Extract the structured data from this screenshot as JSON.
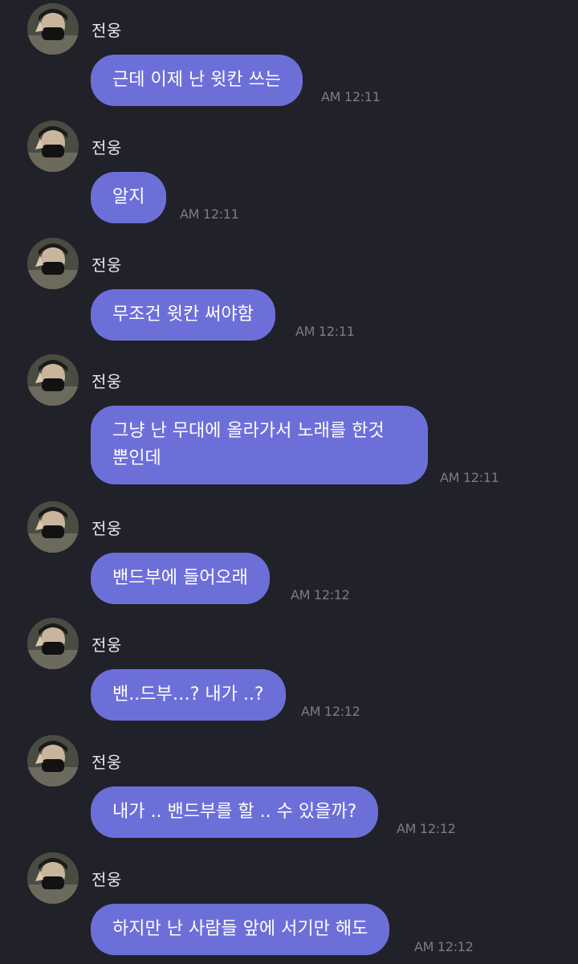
{
  "sender_name": "전웅",
  "messages": [
    {
      "text": "근데 이제 난 윗칸 쓰는",
      "time": "AM 12:11"
    },
    {
      "text": "알지",
      "time": "AM 12:11"
    },
    {
      "text": "무조건 윗칸 써야함",
      "time": "AM 12:11"
    },
    {
      "text": "그냥 난 무대에 올라가서 노래를 한것\n뿐인데",
      "time": "AM 12:11"
    },
    {
      "text": "밴드부에 들어오래",
      "time": "AM 12:12"
    },
    {
      "text": "밴..드부…? 내가 ..?",
      "time": "AM 12:12"
    },
    {
      "text": "내가 .. 밴드부를 할 .. 수 있을까?",
      "time": "AM 12:12"
    },
    {
      "text": "하지만 난 사람들 앞에 서기만 해도",
      "time": "AM 12:12"
    }
  ],
  "colors": {
    "background": "#212129",
    "bubble": "#6d6fd9",
    "bubble_text": "#ffffff",
    "timestamp": "#7c7c86",
    "sender_name": "#e9e9ee"
  }
}
